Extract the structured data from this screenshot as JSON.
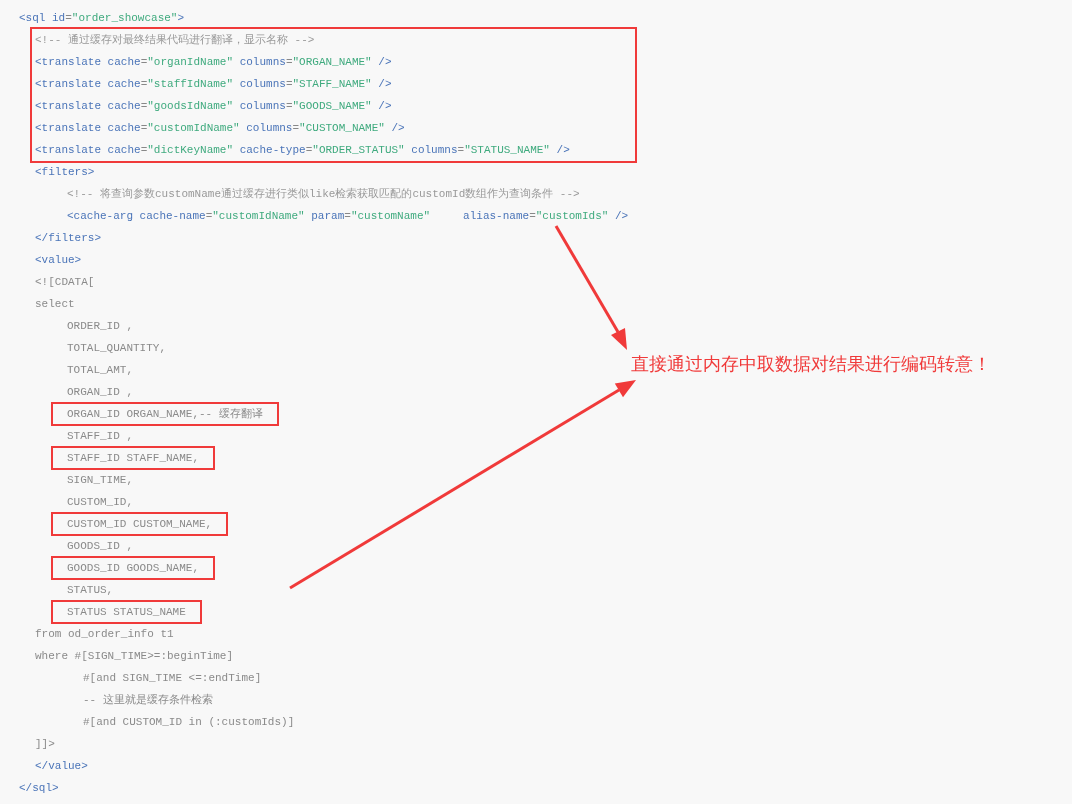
{
  "code": {
    "lines": [
      {
        "kind": "line",
        "boxed": false,
        "tokens": [
          {
            "kind": "tag",
            "text": "<sql"
          },
          {
            "kind": "attr",
            "text": " id"
          },
          {
            "kind": "punct",
            "text": "="
          },
          {
            "kind": "string",
            "text": "\"order_showcase\""
          },
          {
            "kind": "tag",
            "text": ">"
          }
        ],
        "children": [
          {
            "kind": "group",
            "boxed": true,
            "children": [
              {
                "boxed": false,
                "tokens": [
                  {
                    "kind": "comment",
                    "text": "<!-- 通过缓存对最终结果代码进行翻译，显示名称 -->"
                  }
                ]
              },
              {
                "boxed": false,
                "tokens": [
                  {
                    "kind": "tag",
                    "text": "<translate"
                  },
                  {
                    "kind": "attr",
                    "text": " cache"
                  },
                  {
                    "kind": "punct",
                    "text": "="
                  },
                  {
                    "kind": "string",
                    "text": "\"organIdName\""
                  },
                  {
                    "kind": "attr",
                    "text": " columns"
                  },
                  {
                    "kind": "punct",
                    "text": "="
                  },
                  {
                    "kind": "string",
                    "text": "\"ORGAN_NAME\""
                  },
                  {
                    "kind": "tag",
                    "text": " />"
                  }
                ]
              },
              {
                "boxed": false,
                "tokens": [
                  {
                    "kind": "tag",
                    "text": "<translate"
                  },
                  {
                    "kind": "attr",
                    "text": " cache"
                  },
                  {
                    "kind": "punct",
                    "text": "="
                  },
                  {
                    "kind": "string",
                    "text": "\"staffIdName\""
                  },
                  {
                    "kind": "attr",
                    "text": " columns"
                  },
                  {
                    "kind": "punct",
                    "text": "="
                  },
                  {
                    "kind": "string",
                    "text": "\"STAFF_NAME\""
                  },
                  {
                    "kind": "tag",
                    "text": " />"
                  }
                ]
              },
              {
                "boxed": false,
                "tokens": [
                  {
                    "kind": "tag",
                    "text": "<translate"
                  },
                  {
                    "kind": "attr",
                    "text": " cache"
                  },
                  {
                    "kind": "punct",
                    "text": "="
                  },
                  {
                    "kind": "string",
                    "text": "\"goodsIdName\""
                  },
                  {
                    "kind": "attr",
                    "text": " columns"
                  },
                  {
                    "kind": "punct",
                    "text": "="
                  },
                  {
                    "kind": "string",
                    "text": "\"GOODS_NAME\""
                  },
                  {
                    "kind": "tag",
                    "text": " />"
                  }
                ]
              },
              {
                "boxed": false,
                "tokens": [
                  {
                    "kind": "tag",
                    "text": "<translate"
                  },
                  {
                    "kind": "attr",
                    "text": " cache"
                  },
                  {
                    "kind": "punct",
                    "text": "="
                  },
                  {
                    "kind": "string",
                    "text": "\"customIdName\""
                  },
                  {
                    "kind": "attr",
                    "text": " columns"
                  },
                  {
                    "kind": "punct",
                    "text": "="
                  },
                  {
                    "kind": "string",
                    "text": "\"CUSTOM_NAME\""
                  },
                  {
                    "kind": "tag",
                    "text": " />"
                  }
                ]
              },
              {
                "boxed": false,
                "tokens": [
                  {
                    "kind": "tag",
                    "text": "<translate"
                  },
                  {
                    "kind": "attr",
                    "text": " cache"
                  },
                  {
                    "kind": "punct",
                    "text": "="
                  },
                  {
                    "kind": "string",
                    "text": "\"dictKeyName\""
                  },
                  {
                    "kind": "attr",
                    "text": " cache-type"
                  },
                  {
                    "kind": "punct",
                    "text": "="
                  },
                  {
                    "kind": "string",
                    "text": "\"ORDER_STATUS\""
                  },
                  {
                    "kind": "attr",
                    "text": " columns"
                  },
                  {
                    "kind": "punct",
                    "text": "="
                  },
                  {
                    "kind": "string",
                    "text": "\"STATUS_NAME\""
                  },
                  {
                    "kind": "tag",
                    "text": " />"
                  }
                ]
              }
            ]
          },
          {
            "kind": "list",
            "boxed": false,
            "tokens": [
              {
                "kind": "tag",
                "text": "<filters>"
              }
            ],
            "children": [
              {
                "boxed": false,
                "tokens": [
                  {
                    "kind": "comment",
                    "text": "<!-- 将查询参数customName通过缓存进行类似like检索获取匹配的customId数组作为查询条件 -->"
                  }
                ]
              },
              {
                "boxed": false,
                "tokens": [
                  {
                    "kind": "tag",
                    "text": "<cache-arg"
                  },
                  {
                    "kind": "attr",
                    "text": " cache-name"
                  },
                  {
                    "kind": "punct",
                    "text": "="
                  },
                  {
                    "kind": "string",
                    "text": "\"customIdName\""
                  },
                  {
                    "kind": "attr",
                    "text": " param"
                  },
                  {
                    "kind": "punct",
                    "text": "="
                  },
                  {
                    "kind": "string",
                    "text": "\"customName\""
                  },
                  {
                    "kind": "attr",
                    "text": "     alias-name"
                  },
                  {
                    "kind": "punct",
                    "text": "="
                  },
                  {
                    "kind": "string",
                    "text": "\"customIds\""
                  },
                  {
                    "kind": "tag",
                    "text": " />"
                  }
                ]
              }
            ]
          },
          {
            "boxed": false,
            "tokens": [
              {
                "kind": "tag",
                "text": "</filters>"
              }
            ]
          },
          {
            "boxed": false,
            "tokens": [
              {
                "kind": "tag",
                "text": "<value>"
              }
            ]
          },
          {
            "boxed": false,
            "tokens": [
              {
                "kind": "text",
                "text": "<![CDATA["
              }
            ]
          },
          {
            "kind": "list",
            "boxed": false,
            "tokens": [
              {
                "kind": "text",
                "text": "select"
              }
            ],
            "children": [
              {
                "boxed": false,
                "tokens": [
                  {
                    "kind": "text",
                    "text": "ORDER_ID ,"
                  }
                ]
              },
              {
                "boxed": false,
                "tokens": [
                  {
                    "kind": "text",
                    "text": "TOTAL_QUANTITY,"
                  }
                ]
              },
              {
                "boxed": false,
                "tokens": [
                  {
                    "kind": "text",
                    "text": "TOTAL_AMT,"
                  }
                ]
              },
              {
                "boxed": false,
                "tokens": [
                  {
                    "kind": "text",
                    "text": "ORGAN_ID ,"
                  }
                ]
              },
              {
                "boxed": true,
                "tokens": [
                  {
                    "kind": "text",
                    "text": "ORGAN_ID ORGAN_NAME,-- 缓存翻译"
                  }
                ]
              },
              {
                "boxed": false,
                "tokens": [
                  {
                    "kind": "text",
                    "text": "STAFF_ID ,"
                  }
                ]
              },
              {
                "boxed": true,
                "tokens": [
                  {
                    "kind": "text",
                    "text": "STAFF_ID STAFF_NAME,"
                  }
                ]
              },
              {
                "boxed": false,
                "tokens": [
                  {
                    "kind": "text",
                    "text": "SIGN_TIME,"
                  }
                ]
              },
              {
                "boxed": false,
                "tokens": [
                  {
                    "kind": "text",
                    "text": "CUSTOM_ID,"
                  }
                ]
              },
              {
                "boxed": true,
                "tokens": [
                  {
                    "kind": "text",
                    "text": "CUSTOM_ID CUSTOM_NAME,"
                  }
                ]
              },
              {
                "boxed": false,
                "tokens": [
                  {
                    "kind": "text",
                    "text": "GOODS_ID ,"
                  }
                ]
              },
              {
                "boxed": true,
                "tokens": [
                  {
                    "kind": "text",
                    "text": "GOODS_ID GOODS_NAME,"
                  }
                ]
              },
              {
                "boxed": false,
                "tokens": [
                  {
                    "kind": "text",
                    "text": "STATUS,"
                  }
                ]
              },
              {
                "boxed": true,
                "tokens": [
                  {
                    "kind": "text",
                    "text": "STATUS STATUS_NAME"
                  }
                ]
              }
            ]
          },
          {
            "boxed": false,
            "tokens": [
              {
                "kind": "text",
                "text": "from od_order_info t1"
              }
            ]
          },
          {
            "kind": "cont",
            "boxed": false,
            "tokens": [
              {
                "kind": "text",
                "text": "where #[SIGN_TIME>=:beginTime]"
              }
            ],
            "children": [
              {
                "boxed": false,
                "tokens": [
                  {
                    "kind": "text",
                    "text": "#[and SIGN_TIME <=:endTime]"
                  }
                ]
              },
              {
                "boxed": false,
                "tokens": [
                  {
                    "kind": "text",
                    "text": "-- 这里就是缓存条件检索"
                  }
                ]
              },
              {
                "boxed": false,
                "tokens": [
                  {
                    "kind": "text",
                    "text": "#[and CUSTOM_ID in (:customIds)]"
                  }
                ]
              }
            ]
          },
          {
            "boxed": false,
            "tokens": [
              {
                "kind": "text",
                "text": "]]>"
              }
            ]
          },
          {
            "boxed": false,
            "tokens": [
              {
                "kind": "tag",
                "text": "</value>"
              }
            ]
          }
        ]
      },
      {
        "boxed": false,
        "tokens": [
          {
            "kind": "tag",
            "text": "</sql>"
          }
        ]
      }
    ]
  },
  "annotation": {
    "text": "直接通过内存中取数据对结果进行编码转意！"
  }
}
